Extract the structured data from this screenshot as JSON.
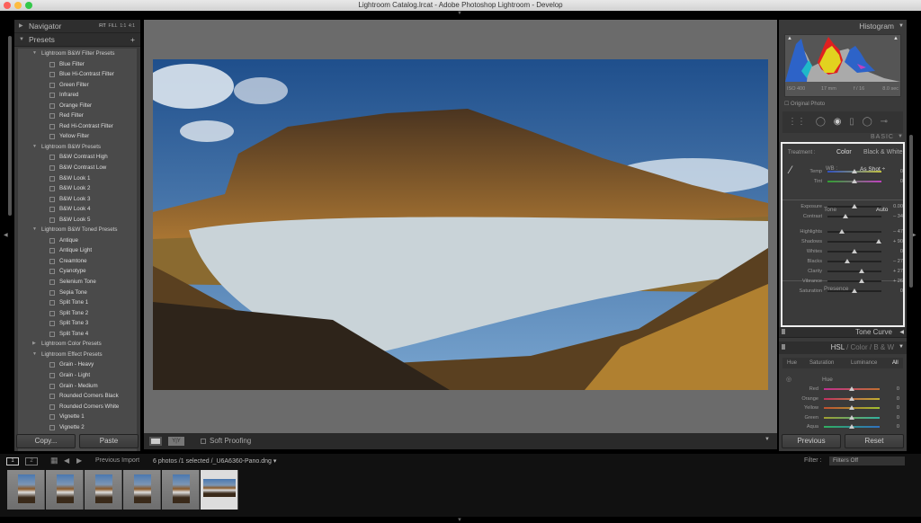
{
  "window": {
    "title": "Lightroom Catalog.lrcat - Adobe Photoshop Lightroom - Develop"
  },
  "navigator": {
    "title": "Navigator",
    "zoom_options": [
      "FIT",
      "FILL",
      "1:1",
      "4:1"
    ]
  },
  "presets": {
    "title": "Presets",
    "add_label": "+",
    "groups": [
      {
        "name": "Lightroom B&W Filter Presets",
        "expanded": true,
        "items": [
          "Blue Filter",
          "Blue Hi-Contrast Filter",
          "Green Filter",
          "Infrared",
          "Orange Filter",
          "Red Filter",
          "Red Hi-Contrast Filter",
          "Yellow Filter"
        ]
      },
      {
        "name": "Lightroom B&W Presets",
        "expanded": true,
        "items": [
          "B&W Contrast High",
          "B&W Contrast Low",
          "B&W Look 1",
          "B&W Look 2",
          "B&W Look 3",
          "B&W Look 4",
          "B&W Look 5"
        ]
      },
      {
        "name": "Lightroom B&W Toned Presets",
        "expanded": true,
        "items": [
          "Antique",
          "Antique Light",
          "Creamtone",
          "Cyanotype",
          "Selenium Tone",
          "Sepia Tone",
          "Split Tone 1",
          "Split Tone 2",
          "Split Tone 3",
          "Split Tone 4"
        ]
      },
      {
        "name": "Lightroom Color Presets",
        "expanded": false,
        "items": []
      },
      {
        "name": "Lightroom Effect Presets",
        "expanded": true,
        "items": [
          "Grain - Heavy",
          "Grain - Light",
          "Grain - Medium",
          "Rounded Corners Black",
          "Rounded Corners White",
          "Vignette 1",
          "Vignette 2"
        ]
      }
    ]
  },
  "left_buttons": {
    "copy": "Copy...",
    "paste": "Paste"
  },
  "toolbar": {
    "soft_proofing": "Soft Proofing"
  },
  "histogram": {
    "title": "Histogram",
    "iso": "ISO 400",
    "focal": "17 mm",
    "aperture": "f / 16",
    "shutter": "8.0 sec",
    "original_photo": "Original Photo"
  },
  "basic": {
    "title": "Basic",
    "treatment_label": "Treatment :",
    "treatment_color": "Color",
    "treatment_bw": "Black & White",
    "wb_label": "WB :",
    "wb_value": "As Shot",
    "tone_label": "Tone",
    "auto_label": "Auto",
    "presence_label": "Presence",
    "sliders": [
      {
        "label": "Temp",
        "value": "0",
        "position": 0.5
      },
      {
        "label": "Tint",
        "value": "0",
        "position": 0.5
      },
      {
        "label": "Exposure",
        "value": "0.00",
        "position": 0.5
      },
      {
        "label": "Contrast",
        "value": "– 34",
        "position": 0.33
      },
      {
        "label": "Highlights",
        "value": "– 47",
        "position": 0.265
      },
      {
        "label": "Shadows",
        "value": "+ 90",
        "position": 0.95
      },
      {
        "label": "Whites",
        "value": "0",
        "position": 0.5
      },
      {
        "label": "Blacks",
        "value": "– 27",
        "position": 0.365
      },
      {
        "label": "Clarity",
        "value": "+ 27",
        "position": 0.635
      },
      {
        "label": "Vibrance",
        "value": "+ 26",
        "position": 0.63
      },
      {
        "label": "Saturation",
        "value": "0",
        "position": 0.5
      }
    ]
  },
  "tone_curve": {
    "title": "Tone Curve"
  },
  "hsl": {
    "title_hsl": "HSL",
    "title_color": "Color",
    "title_bw": "B & W",
    "tabs": [
      "Hue",
      "Saturation",
      "Luminance",
      "All"
    ],
    "section": "Hue",
    "sliders": [
      {
        "label": "Red",
        "value": "0",
        "position": 0.5
      },
      {
        "label": "Orange",
        "value": "0",
        "position": 0.5
      },
      {
        "label": "Yellow",
        "value": "0",
        "position": 0.5
      },
      {
        "label": "Green",
        "value": "0",
        "position": 0.5
      },
      {
        "label": "Aqua",
        "value": "0",
        "position": 0.5
      }
    ]
  },
  "right_buttons": {
    "previous": "Previous",
    "reset": "Reset"
  },
  "filmstrip": {
    "view1": "1",
    "view2": "2",
    "source": "Previous Import",
    "info": "6 photos /1 selected /_U6A6360-Pano.dng",
    "filter_label": "Filter :",
    "filter_value": "Filters Off",
    "thumb_count": 6,
    "selected_index": 5
  }
}
